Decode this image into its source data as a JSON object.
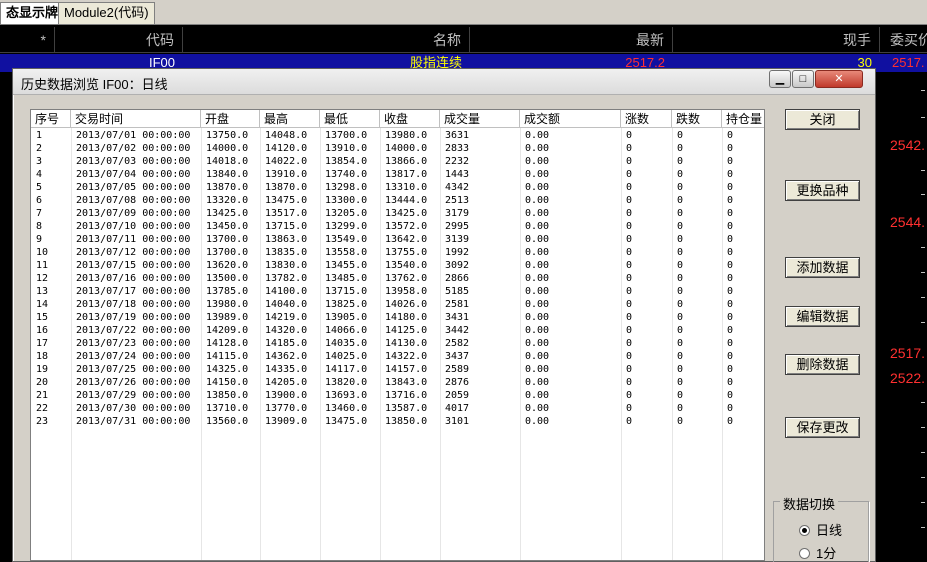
{
  "tabs": [
    {
      "label": "态显示牌"
    },
    {
      "label": "Module2(代码)"
    }
  ],
  "quote_grid": {
    "headers": {
      "star": "*",
      "code": "代码",
      "name": "名称",
      "latest": "最新",
      "volume": "现手",
      "bid": "委买价"
    },
    "selected_row": {
      "code": "IF00",
      "name": "股指连续",
      "latest": "2517.2",
      "volume": "30",
      "bid": "2517."
    },
    "right_values": [
      "2542.",
      "2544.",
      "2517.",
      "2522."
    ]
  },
  "dialog": {
    "title": "历史数据浏览 IF00：日线",
    "window_buttons": {
      "min": "▁",
      "max": "□",
      "close": "✕"
    },
    "columns": [
      "序号",
      "交易时间",
      "开盘",
      "最高",
      "最低",
      "收盘",
      "成交量",
      "成交额",
      "涨数",
      "跌数",
      "持仓量"
    ],
    "rows": [
      [
        "1",
        "2013/07/01 00:00:00",
        "13750.0",
        "14048.0",
        "13700.0",
        "13980.0",
        "3631",
        "0.00",
        "0",
        "0",
        "0"
      ],
      [
        "2",
        "2013/07/02 00:00:00",
        "14000.0",
        "14120.0",
        "13910.0",
        "14000.0",
        "2833",
        "0.00",
        "0",
        "0",
        "0"
      ],
      [
        "3",
        "2013/07/03 00:00:00",
        "14018.0",
        "14022.0",
        "13854.0",
        "13866.0",
        "2232",
        "0.00",
        "0",
        "0",
        "0"
      ],
      [
        "4",
        "2013/07/04 00:00:00",
        "13840.0",
        "13910.0",
        "13740.0",
        "13817.0",
        "1443",
        "0.00",
        "0",
        "0",
        "0"
      ],
      [
        "5",
        "2013/07/05 00:00:00",
        "13870.0",
        "13870.0",
        "13298.0",
        "13310.0",
        "4342",
        "0.00",
        "0",
        "0",
        "0"
      ],
      [
        "6",
        "2013/07/08 00:00:00",
        "13320.0",
        "13475.0",
        "13300.0",
        "13444.0",
        "2513",
        "0.00",
        "0",
        "0",
        "0"
      ],
      [
        "7",
        "2013/07/09 00:00:00",
        "13425.0",
        "13517.0",
        "13205.0",
        "13425.0",
        "3179",
        "0.00",
        "0",
        "0",
        "0"
      ],
      [
        "8",
        "2013/07/10 00:00:00",
        "13450.0",
        "13715.0",
        "13299.0",
        "13572.0",
        "2995",
        "0.00",
        "0",
        "0",
        "0"
      ],
      [
        "9",
        "2013/07/11 00:00:00",
        "13700.0",
        "13863.0",
        "13549.0",
        "13642.0",
        "3139",
        "0.00",
        "0",
        "0",
        "0"
      ],
      [
        "10",
        "2013/07/12 00:00:00",
        "13700.0",
        "13835.0",
        "13558.0",
        "13755.0",
        "1992",
        "0.00",
        "0",
        "0",
        "0"
      ],
      [
        "11",
        "2013/07/15 00:00:00",
        "13620.0",
        "13830.0",
        "13455.0",
        "13540.0",
        "3092",
        "0.00",
        "0",
        "0",
        "0"
      ],
      [
        "12",
        "2013/07/16 00:00:00",
        "13500.0",
        "13782.0",
        "13485.0",
        "13762.0",
        "2866",
        "0.00",
        "0",
        "0",
        "0"
      ],
      [
        "13",
        "2013/07/17 00:00:00",
        "13785.0",
        "14100.0",
        "13715.0",
        "13958.0",
        "5185",
        "0.00",
        "0",
        "0",
        "0"
      ],
      [
        "14",
        "2013/07/18 00:00:00",
        "13980.0",
        "14040.0",
        "13825.0",
        "14026.0",
        "2581",
        "0.00",
        "0",
        "0",
        "0"
      ],
      [
        "15",
        "2013/07/19 00:00:00",
        "13989.0",
        "14219.0",
        "13905.0",
        "14180.0",
        "3431",
        "0.00",
        "0",
        "0",
        "0"
      ],
      [
        "16",
        "2013/07/22 00:00:00",
        "14209.0",
        "14320.0",
        "14066.0",
        "14125.0",
        "3442",
        "0.00",
        "0",
        "0",
        "0"
      ],
      [
        "17",
        "2013/07/23 00:00:00",
        "14128.0",
        "14185.0",
        "14035.0",
        "14130.0",
        "2582",
        "0.00",
        "0",
        "0",
        "0"
      ],
      [
        "18",
        "2013/07/24 00:00:00",
        "14115.0",
        "14362.0",
        "14025.0",
        "14322.0",
        "3437",
        "0.00",
        "0",
        "0",
        "0"
      ],
      [
        "19",
        "2013/07/25 00:00:00",
        "14325.0",
        "14335.0",
        "14117.0",
        "14157.0",
        "2589",
        "0.00",
        "0",
        "0",
        "0"
      ],
      [
        "20",
        "2013/07/26 00:00:00",
        "14150.0",
        "14205.0",
        "13820.0",
        "13843.0",
        "2876",
        "0.00",
        "0",
        "0",
        "0"
      ],
      [
        "21",
        "2013/07/29 00:00:00",
        "13850.0",
        "13900.0",
        "13693.0",
        "13716.0",
        "2059",
        "0.00",
        "0",
        "0",
        "0"
      ],
      [
        "22",
        "2013/07/30 00:00:00",
        "13710.0",
        "13770.0",
        "13460.0",
        "13587.0",
        "4017",
        "0.00",
        "0",
        "0",
        "0"
      ],
      [
        "23",
        "2013/07/31 00:00:00",
        "13560.0",
        "13909.0",
        "13475.0",
        "13850.0",
        "3101",
        "0.00",
        "0",
        "0",
        "0"
      ]
    ],
    "buttons": {
      "close": "关闭",
      "change_symbol": "更换品种",
      "add_data": "添加数据",
      "edit_data": "编辑数据",
      "delete_data": "删除数据",
      "save_changes": "保存更改"
    },
    "period_group": {
      "title": "数据切换",
      "options": [
        "日线",
        "1分"
      ],
      "selected": "日线"
    }
  }
}
